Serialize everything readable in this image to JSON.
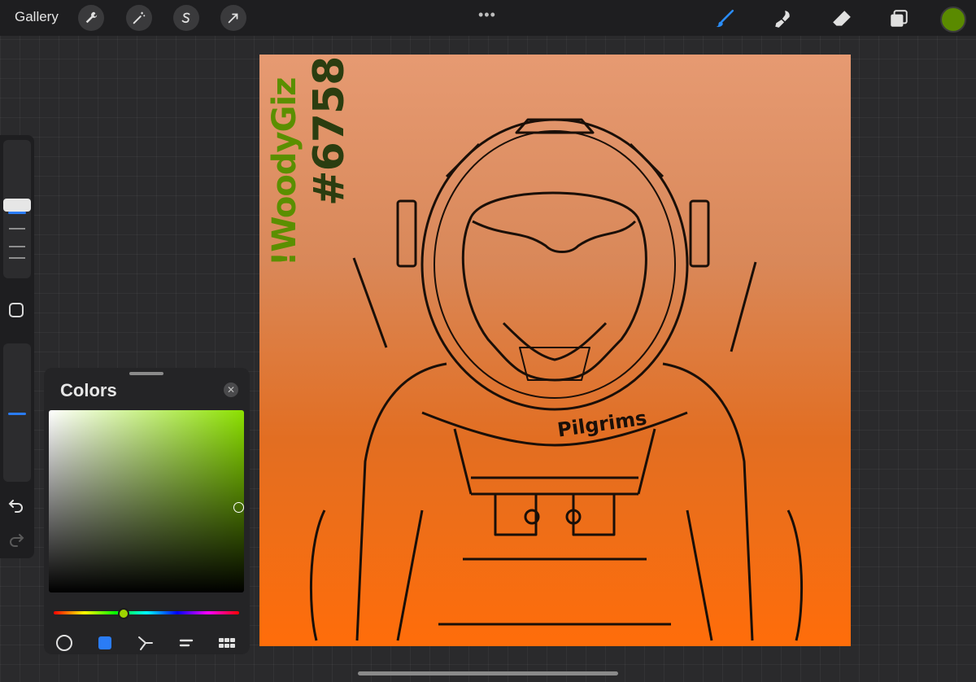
{
  "topbar": {
    "gallery_label": "Gallery",
    "left_tools": [
      "wrench-icon",
      "magic-wand-icon",
      "selection-s-icon",
      "transform-arrow-icon"
    ],
    "more_dots": "•••",
    "right_tools": [
      "brush-icon",
      "smudge-icon",
      "eraser-icon",
      "layers-icon"
    ],
    "active_tool": "brush-icon",
    "current_color": "#5a8a00"
  },
  "sidebar": {
    "brush_size_handle": "top",
    "opacity_handle": "middle"
  },
  "canvas": {
    "signature_name": "!WoodyGiz",
    "signature_number": "#6758",
    "badge_text": "Pilgrims",
    "gradient_top": "#e69a72",
    "gradient_bottom": "#ff6d0a"
  },
  "colors_panel": {
    "title": "Colors",
    "close_icon": "close-icon",
    "hue_color": "#8ce000",
    "tabs": [
      "disc-icon",
      "classic-square-icon",
      "harmony-icon",
      "value-icon",
      "palettes-icon"
    ],
    "active_tab": "classic-square-icon"
  }
}
